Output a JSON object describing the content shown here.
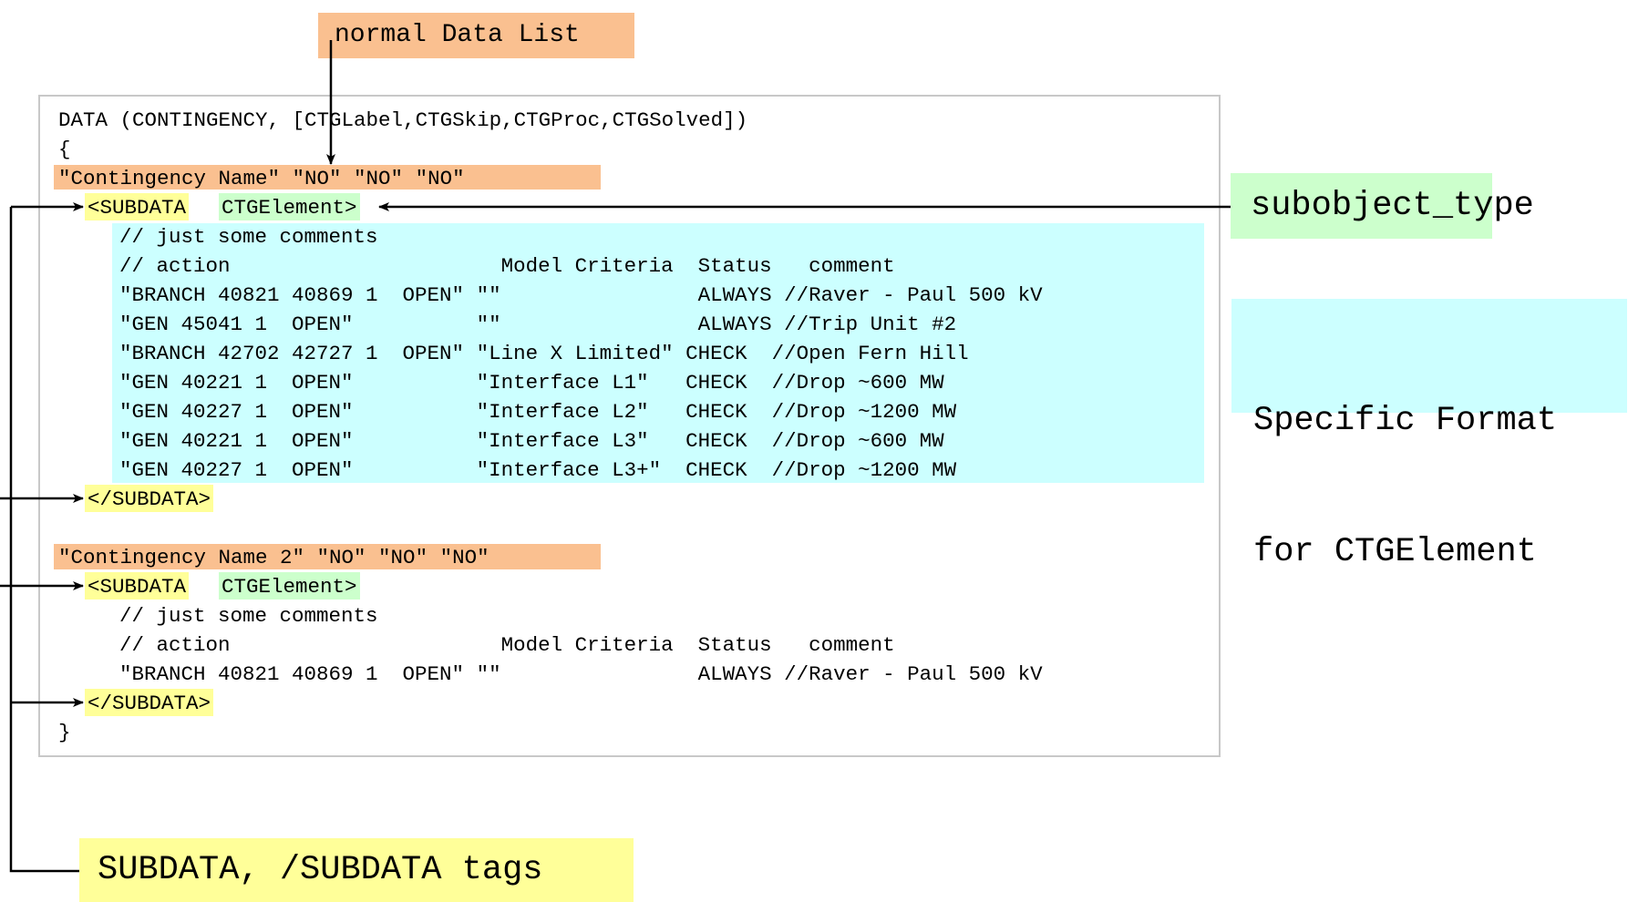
{
  "callouts": {
    "normal_data_list": "normal Data List",
    "subobject_type": "subobject_type",
    "specific_format_line1": "Specific Format",
    "specific_format_line2": "for CTGElement",
    "subdata_tags": "SUBDATA, /SUBDATA tags"
  },
  "code": {
    "header": "DATA (CONTINGENCY, [CTGLabel,CTGSkip,CTGProc,CTGSolved])",
    "open_brace": "{",
    "record1": "\"Contingency Name\" \"NO\" \"NO\" \"NO\"",
    "subdata_open_tag": "<SUBDATA",
    "subdata_type": "CTGElement>",
    "block1": [
      "// just some comments",
      "// action                      Model Criteria  Status   comment",
      "\"BRANCH 40821 40869 1  OPEN\" \"\"                ALWAYS //Raver - Paul 500 kV",
      "\"GEN 45041 1  OPEN\"          \"\"                ALWAYS //Trip Unit #2",
      "\"BRANCH 42702 42727 1  OPEN\" \"Line X Limited\" CHECK  //Open Fern Hill",
      "\"GEN 40221 1  OPEN\"          \"Interface L1\"   CHECK  //Drop ~600 MW",
      "\"GEN 40227 1  OPEN\"          \"Interface L2\"   CHECK  //Drop ~1200 MW",
      "\"GEN 40221 1  OPEN\"          \"Interface L3\"   CHECK  //Drop ~600 MW",
      "\"GEN 40227 1  OPEN\"          \"Interface L3+\"  CHECK  //Drop ~1200 MW"
    ],
    "subdata_close_tag": "</SUBDATA>",
    "record2": "\"Contingency Name 2\" \"NO\" \"NO\" \"NO\"",
    "block2": [
      "// just some comments",
      "// action                      Model Criteria  Status   comment",
      "\"BRANCH 40821 40869 1  OPEN\" \"\"                ALWAYS //Raver - Paul 500 kV"
    ],
    "close_brace": "}"
  }
}
